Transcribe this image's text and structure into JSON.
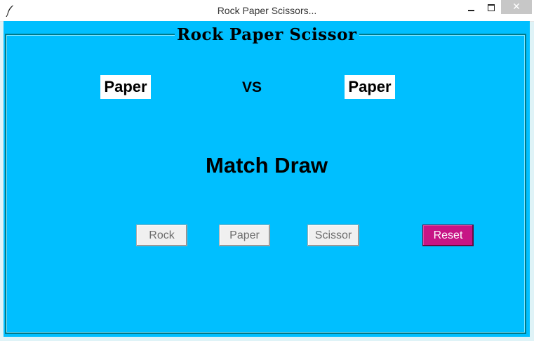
{
  "window": {
    "title": "Rock Paper Scissors...",
    "close_glyph": "✕"
  },
  "game": {
    "frame_title": "Rock Paper Scissor",
    "player_choice": "Paper",
    "vs_label": "VS",
    "computer_choice": "Paper",
    "result": "Match Draw"
  },
  "buttons": {
    "rock": "Rock",
    "paper": "Paper",
    "scissor": "Scissor",
    "reset": "Reset"
  },
  "colors": {
    "background": "#00bfff",
    "reset_button": "#c71585",
    "choice_box": "#ffffff"
  },
  "icons": {
    "app": "feather-icon",
    "minimize": "minimize-icon",
    "maximize": "maximize-icon",
    "close": "close-icon"
  }
}
